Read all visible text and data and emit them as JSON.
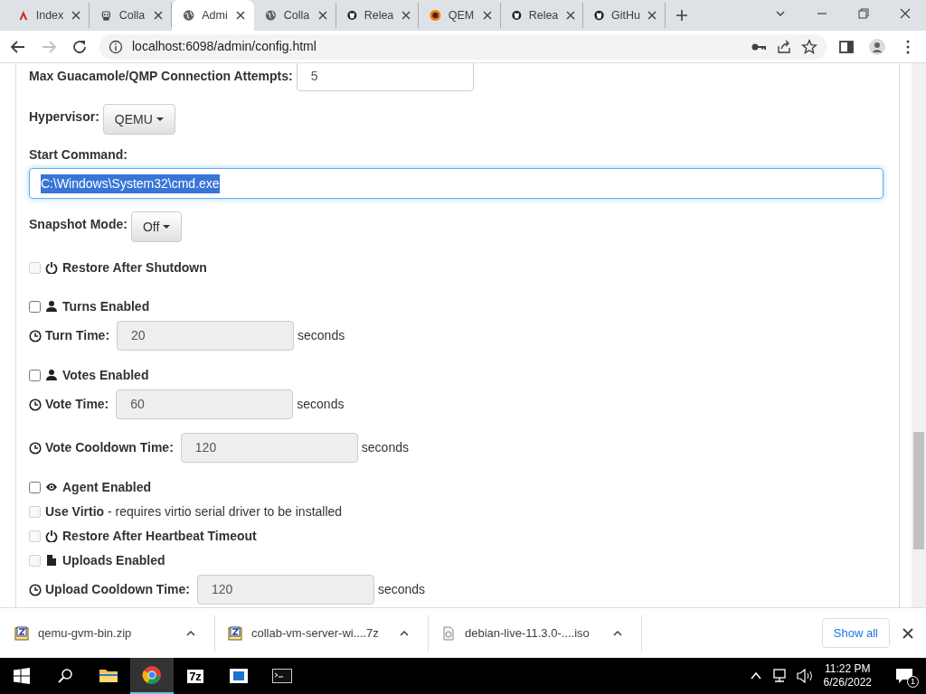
{
  "browser": {
    "tabs": [
      {
        "title": "Index",
        "selected": false
      },
      {
        "title": "Colla",
        "selected": false
      },
      {
        "title": "Admi",
        "selected": true
      },
      {
        "title": "Colla",
        "selected": false
      },
      {
        "title": "Relea",
        "selected": false
      },
      {
        "title": "QEM",
        "selected": false
      },
      {
        "title": "Relea",
        "selected": false
      },
      {
        "title": "GitHu",
        "selected": false
      }
    ],
    "url": "localhost:6098/admin/config.html",
    "forward_disabled": true
  },
  "form": [
    {
      "kind": "number",
      "label": "Max Guacamole/QMP Connection Attempts:",
      "value": "5"
    },
    {
      "kind": "dropdown",
      "label": "Hypervisor:",
      "value": "QEMU"
    },
    {
      "kind": "command",
      "label": "Start Command:",
      "value": "C:\\Windows\\System32\\cmd.exe",
      "text_selected": true
    },
    {
      "kind": "dropdown",
      "label": "Snapshot Mode:",
      "value": "Off"
    },
    {
      "kind": "checkbox",
      "label": "Restore After Shutdown",
      "checked": false,
      "disabled": true
    },
    {
      "kind": "checkbox",
      "label": "Turns Enabled",
      "checked": false,
      "disabled": false
    },
    {
      "kind": "timed",
      "label": "Turn Time:",
      "value": "20",
      "unit": "seconds",
      "disabled": true
    },
    {
      "kind": "checkbox",
      "label": "Votes Enabled",
      "checked": false,
      "disabled": false
    },
    {
      "kind": "timed",
      "label": "Vote Time:",
      "value": "60",
      "unit": "seconds",
      "disabled": true
    },
    {
      "kind": "timed",
      "label": "Vote Cooldown Time:",
      "value": "120",
      "unit": "seconds",
      "disabled": true
    },
    {
      "kind": "checkbox",
      "label": "Agent Enabled",
      "checked": false,
      "disabled": false
    },
    {
      "kind": "checkbox",
      "label": "**Use Virtio** - requires virtio serial driver to be installed",
      "checked": false,
      "disabled": true
    },
    {
      "kind": "checkbox",
      "label": "Restore After Heartbeat Timeout",
      "checked": false,
      "disabled": true
    },
    {
      "kind": "checkbox",
      "label": "Uploads Enabled",
      "checked": false,
      "disabled": true
    },
    {
      "kind": "timed",
      "label": "Upload Cooldown Time:",
      "value": "120",
      "unit": "seconds",
      "disabled": true
    }
  ],
  "downloads": {
    "items": [
      {
        "name": "qemu-gvm-bin.zip"
      },
      {
        "name": "collab-vm-server-wi....7z"
      },
      {
        "name": "debian-live-11.3.0-....iso"
      }
    ],
    "show_all": "Show all"
  },
  "taskbar": {
    "apps": [
      {
        "active": false
      },
      {
        "active": true
      },
      {
        "text": "7z",
        "active": false
      },
      {
        "active": false
      },
      {
        "active": false
      }
    ],
    "time": "11:22 PM",
    "date": "6/26/2022",
    "notifications": "1"
  }
}
